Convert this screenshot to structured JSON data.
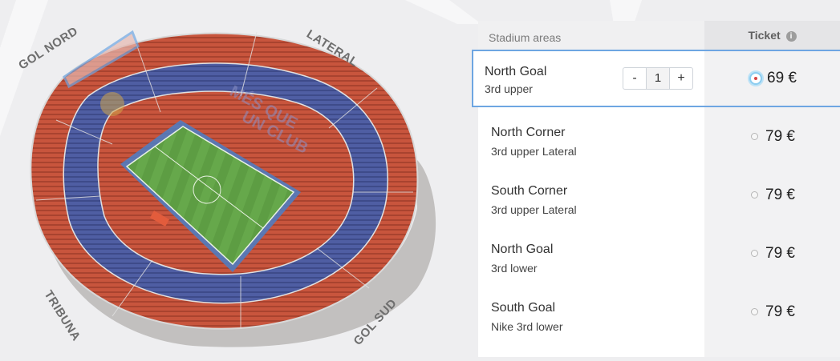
{
  "stadium": {
    "labels": {
      "gol_nord": "GOL NORD",
      "lateral": "LATERAL",
      "tribuna": "TRIBUNA",
      "gol_sud": "GOL SUD"
    }
  },
  "panel": {
    "header_areas": "Stadium areas",
    "header_ticket": "Ticket",
    "info_icon": "i"
  },
  "rows": [
    {
      "name": "North Goal",
      "sub": "3rd upper",
      "price": "69 €",
      "quantity": "1",
      "selected": true
    },
    {
      "name": "North Corner",
      "sub": "3rd upper Lateral",
      "price": "79 €",
      "selected": false
    },
    {
      "name": "South Corner",
      "sub": "3rd upper Lateral",
      "price": "79 €",
      "selected": false
    },
    {
      "name": "North Goal",
      "sub": "3rd lower",
      "price": "79 €",
      "selected": false
    },
    {
      "name": "South Goal",
      "sub": "Nike 3rd lower",
      "price": "79 €",
      "selected": false
    }
  ],
  "stepper": {
    "minus": "-",
    "plus": "+"
  },
  "colors": {
    "seat_red": "#c8553d",
    "seat_blue": "#4f5ea3",
    "pitch_green": "#63a347",
    "highlight_blue": "#6ea6e2"
  }
}
